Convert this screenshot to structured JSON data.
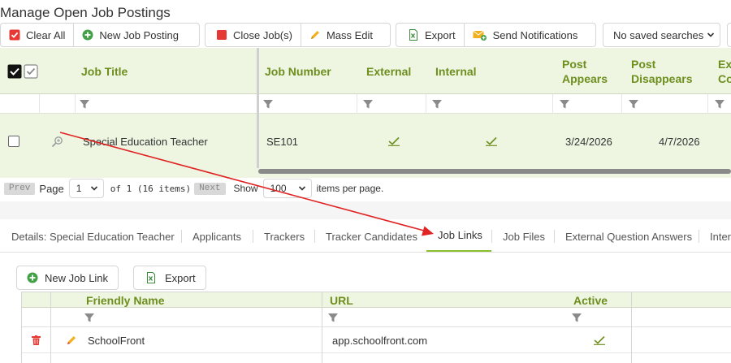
{
  "page": {
    "title": "Manage Open Job Postings"
  },
  "toolbar": {
    "clear_all": "Clear All",
    "new_job_posting": "New Job Posting",
    "close_jobs": "Close Job(s)",
    "mass_edit": "Mass Edit",
    "export": "Export",
    "send_notifications": "Send Notifications",
    "saved_searches": "No saved searches"
  },
  "grid": {
    "columns": {
      "job_title": "Job Title",
      "job_number": "Job Number",
      "external": "External",
      "internal": "Internal",
      "post_appears_1": "Post",
      "post_appears_2": "Appears",
      "post_disappears_1": "Post",
      "post_disappears_2": "Disappears",
      "external_co_1": "Ext",
      "external_co_2": "Co"
    },
    "rows": [
      {
        "job_title": "Special Education Teacher",
        "job_number": "SE101",
        "external": true,
        "internal": true,
        "post_appears": "3/24/2026",
        "post_disappears": "4/7/2026"
      }
    ]
  },
  "pager": {
    "prev": "Prev",
    "page_label": "Page",
    "page_value": "1",
    "of_text": "of 1 (16 items)",
    "next": "Next",
    "show_label": "Show",
    "page_size": "100",
    "per_page_text": "items per page."
  },
  "tabs": [
    "Details: Special Education Teacher",
    "Applicants",
    "Trackers",
    "Tracker Candidates",
    "Job Links",
    "Job Files",
    "External Question Answers",
    "Inter"
  ],
  "active_tab": "Job Links",
  "links_toolbar": {
    "new_job_link": "New Job Link",
    "export": "Export"
  },
  "links_grid": {
    "columns": {
      "friendly_name": "Friendly Name",
      "url": "URL",
      "active": "Active"
    },
    "rows": [
      {
        "friendly_name": "SchoolFront",
        "url": "app.schoolfront.com",
        "active": true
      }
    ]
  },
  "colors": {
    "accent_green": "#6e8e1e",
    "header_bg": "#eef6e2",
    "tab_underline": "#8cbf2e",
    "annotation_arrow": "#e02424",
    "danger_red": "#e53935"
  }
}
